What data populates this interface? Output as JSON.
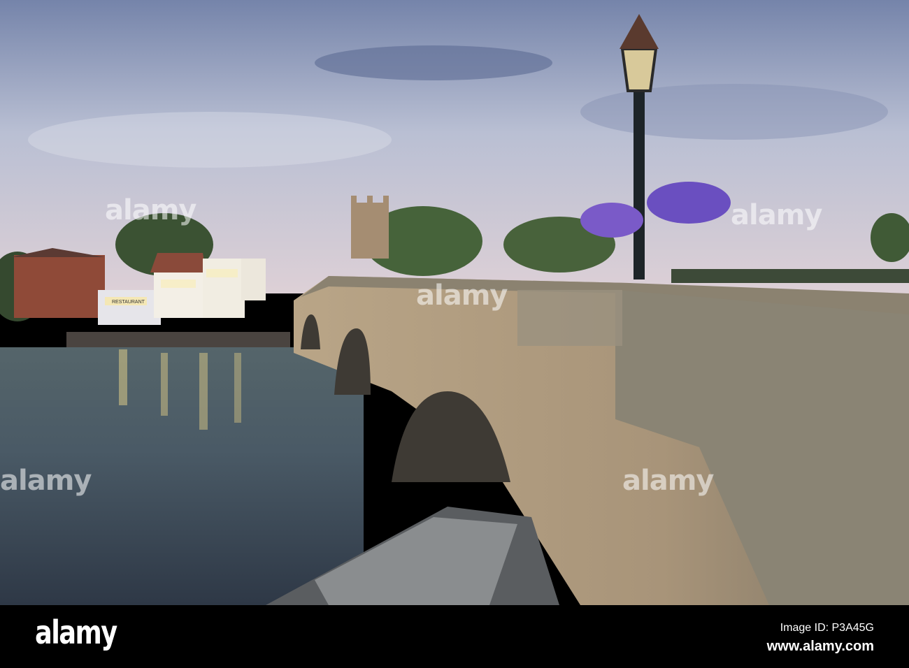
{
  "photo": {
    "watermark": "alamy",
    "sign_text": "RESTAURANT"
  },
  "footer": {
    "logo": "alamy",
    "image_id": "Image ID: P3A45G",
    "website": "www.alamy.com"
  },
  "colors": {
    "sky_top": "#6f7fa6",
    "sky_bottom": "#d9cfd6",
    "water": "#3a4550",
    "stone": "#a08e72",
    "flowers": "#7a5ac8"
  }
}
